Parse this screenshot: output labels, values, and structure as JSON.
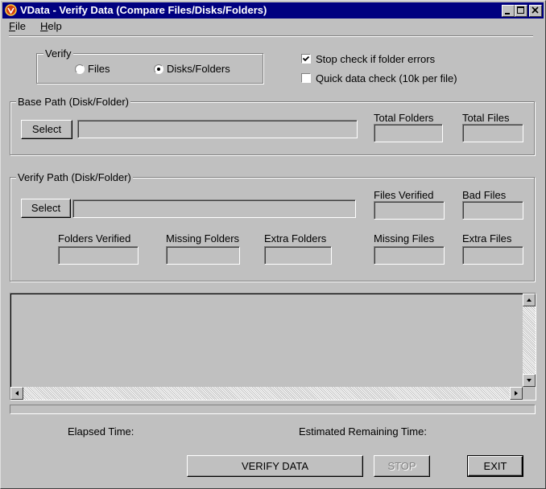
{
  "window": {
    "title": "VData - Verify Data (Compare Files/Disks/Folders)"
  },
  "menu": {
    "file": "File",
    "help": "Help"
  },
  "verify": {
    "legend": "Verify",
    "files_label": "Files",
    "disks_label": "Disks/Folders",
    "selected": "Disks/Folders"
  },
  "options": {
    "stop_check_label": "Stop check if folder errors",
    "stop_check_checked": true,
    "quick_check_label": "Quick data check (10k per file)",
    "quick_check_checked": false
  },
  "base_path": {
    "legend": "Base Path (Disk/Folder)",
    "select_label": "Select",
    "path_value": "",
    "total_folders_label": "Total Folders",
    "total_folders_value": "",
    "total_files_label": "Total Files",
    "total_files_value": ""
  },
  "verify_path": {
    "legend": "Verify Path (Disk/Folder)",
    "select_label": "Select",
    "path_value": "",
    "files_verified_label": "Files Verified",
    "files_verified_value": "",
    "bad_files_label": "Bad Files",
    "bad_files_value": "",
    "folders_verified_label": "Folders Verified",
    "folders_verified_value": "",
    "missing_folders_label": "Missing Folders",
    "missing_folders_value": "",
    "extra_folders_label": "Extra Folders",
    "extra_folders_value": "",
    "missing_files_label": "Missing Files",
    "missing_files_value": "",
    "extra_files_label": "Extra Files",
    "extra_files_value": ""
  },
  "status": {
    "elapsed_label": "Elapsed Time:",
    "elapsed_value": "",
    "remaining_label": "Estimated Remaining Time:",
    "remaining_value": "",
    "progress": 0
  },
  "buttons": {
    "verify_label": "VERIFY DATA",
    "stop_label": "STOP",
    "stop_enabled": false,
    "exit_label": "EXIT"
  }
}
